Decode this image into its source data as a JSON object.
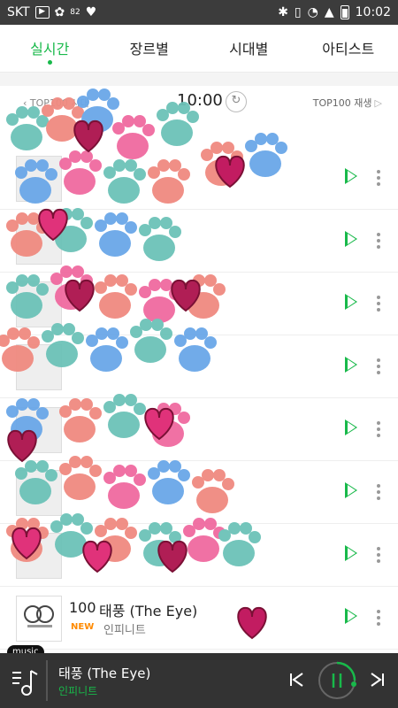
{
  "status_bar": {
    "carrier": "SKT",
    "temp": "82",
    "time": "10:02"
  },
  "tabs": [
    {
      "label": "실시간"
    },
    {
      "label": "장르별"
    },
    {
      "label": "시대별"
    },
    {
      "label": "아티스트"
    }
  ],
  "header": {
    "prev_label": "TOP100 시대",
    "time": "10:00",
    "play_all": "TOP100 재생"
  },
  "songs": [
    {
      "rank": "",
      "title": "",
      "artist": ""
    },
    {
      "rank": "",
      "title": "",
      "artist": ""
    },
    {
      "rank": "",
      "title": "",
      "artist": ""
    },
    {
      "rank": "",
      "title": "",
      "artist": ""
    },
    {
      "rank": "",
      "title": "",
      "artist": ""
    },
    {
      "rank": "",
      "title": "",
      "artist": ""
    },
    {
      "rank": "",
      "title": "",
      "artist": ""
    },
    {
      "rank": "100",
      "title": "태풍 (The Eye)",
      "badge": "NEW",
      "artist": "인피니트"
    }
  ],
  "player": {
    "badge": "music",
    "title": "태풍 (The Eye)",
    "artist": "인피니트"
  },
  "colors": {
    "accent": "#18b94a",
    "new_badge": "#ff8a00",
    "player_bg": "#333333"
  }
}
